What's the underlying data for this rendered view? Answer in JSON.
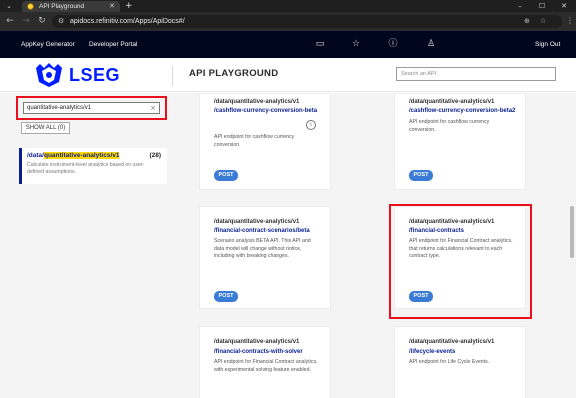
{
  "browser": {
    "tab_title": "API Playground",
    "tab_close": "✕",
    "new_tab": "+",
    "url": "apidocs.refinitiv.com/Apps/ApiDocs#/",
    "window_controls": {
      "minimize": "–",
      "maximize": "☐",
      "close": "✕"
    },
    "nav": {
      "back": "←",
      "forward": "→",
      "reload": "↻"
    },
    "icons": {
      "tab_menu": "chevron-down-icon",
      "site_info": "tune-icon",
      "zoom": "zoom-icon",
      "bookmark": "star-icon",
      "menu": "kebab-icon"
    }
  },
  "site_bar": {
    "links": [
      "AppKey Generator",
      "Developer Portal"
    ],
    "sign_out": "Sign Out",
    "icons": [
      "chat-icon",
      "star-icon",
      "help-icon",
      "user-icon"
    ]
  },
  "header": {
    "logo_text": "LSEG",
    "title": "API PLAYGROUND",
    "search_placeholder": "Search an API"
  },
  "sidebar": {
    "filter_value": "quantitative-analytics/v1",
    "clear_icon": "×",
    "show_all_label": "SHOW ALL (0)",
    "group": {
      "prefix": "/data/",
      "highlight": "quantitative-analytics/v1",
      "count": "(28)",
      "description": "Calculate instrument-level analytics based on user-defined assumptions."
    }
  },
  "cards": [
    {
      "path": "/data/quantitative-analytics/v1",
      "name": "/cashflow-currency-conversion-beta",
      "description": "API endpoint for cashflow currency conversion.",
      "method": "POST",
      "info": "i"
    },
    {
      "path": "/data/quantitative-analytics/v1",
      "name": "/cashflow-currency-conversion-beta2",
      "description": "API endpoint for cashflow currency conversion.",
      "method": "POST"
    },
    {
      "path": "/data/quantitative-analytics/v1",
      "name": "/financial-contract-scenarios/beta",
      "description": "Scenario analysis BETA API. This API and data model will change without notice, including with breaking changes.",
      "method": "POST"
    },
    {
      "path": "/data/quantitative-analytics/v1",
      "name": "/financial-contracts",
      "description": "API endpoint for Financial Contract analytics, that returns calculations relevant to each contract type.",
      "method": "POST"
    },
    {
      "path": "/data/quantitative-analytics/v1",
      "name": "/financial-contracts-with-solver",
      "description": "API endpoint for Financial Contract analytics, with experimental solving feature enabled."
    },
    {
      "path": "/data/quantitative-analytics/v1",
      "name": "/lifecycle-events",
      "description": "API endpoint for Life Cycle Events."
    }
  ]
}
